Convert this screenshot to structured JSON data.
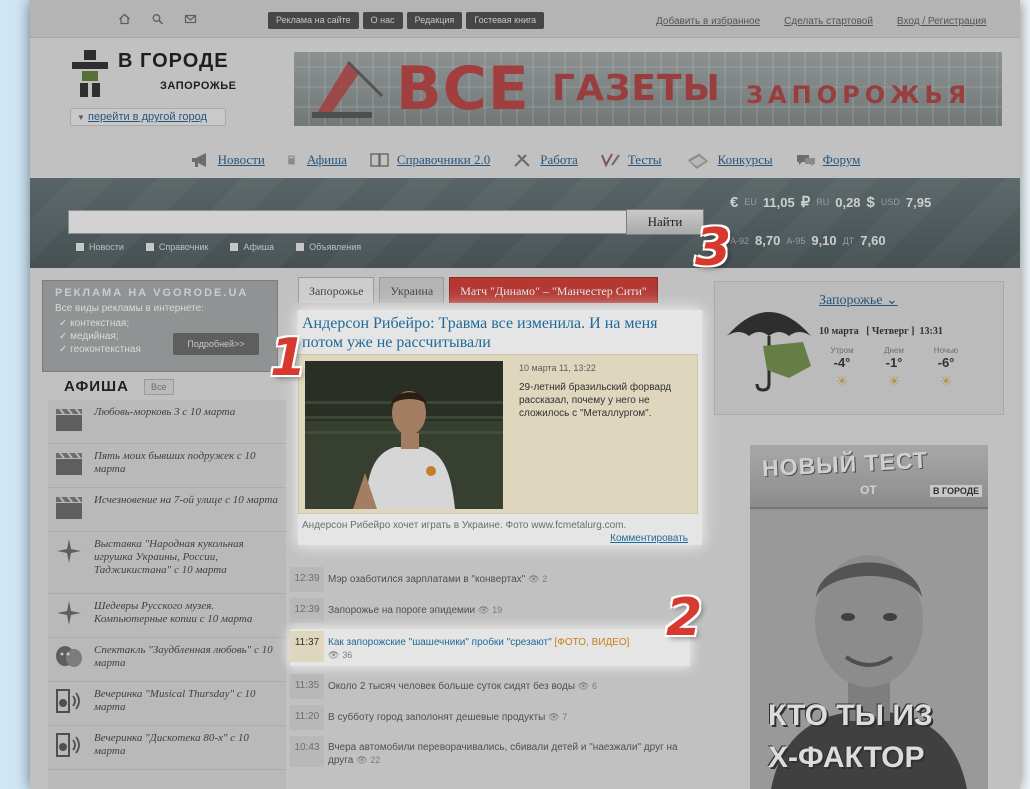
{
  "topbar": {
    "icons": [
      "home-icon",
      "search-icon",
      "mail-icon"
    ],
    "buttons": [
      "Реклама на сайте",
      "О нас",
      "Редакция",
      "Гостевая книга"
    ],
    "links": [
      "Добавить в избранное",
      "Сделать стартовой",
      "Вход / Регистрация"
    ]
  },
  "logo": {
    "title": "В ГОРОДЕ",
    "subtitle": "ЗАПОРОЖЬЕ"
  },
  "city_button": {
    "arrow": "▼",
    "label": "перейти в другой город"
  },
  "banner": {
    "big": "ВСЕ",
    "mid": "ГАЗЕТЫ",
    "small": "ЗАПОРОЖЬЯ"
  },
  "nav": [
    {
      "label": "Новости",
      "icon": "megaphone-icon"
    },
    {
      "label": "Афиша",
      "icon": "ticket-icon"
    },
    {
      "label": "Справочники 2.0",
      "icon": "book-icon"
    },
    {
      "label": "Работа",
      "icon": "tools-icon"
    },
    {
      "label": "Тесты",
      "icon": "test-icon"
    },
    {
      "label": "Конкурсы",
      "icon": "gift-icon"
    },
    {
      "label": "Форум",
      "icon": "forum-icon"
    }
  ],
  "search": {
    "value": "",
    "engine_arrow": "▼",
    "button": "Найти",
    "checks": [
      "Новости",
      "Справочник",
      "Афиша",
      "Объявления"
    ]
  },
  "rates": {
    "eur": {
      "sym": "€",
      "code": "EU",
      "value": "11,05"
    },
    "rub": {
      "sym": "₽",
      "code": "RU",
      "value": "0,28"
    },
    "usd": {
      "sym": "$",
      "code": "USD",
      "value": "7,95"
    }
  },
  "fuel": [
    {
      "code": "A-92",
      "value": "8,70"
    },
    {
      "code": "A-95",
      "value": "9,10"
    },
    {
      "code": "ДТ",
      "value": "7,60"
    }
  ],
  "ad": {
    "title": "РЕКЛАМА НА VGORODE.UA",
    "subtitle": "Все виды рекламы в интернете:",
    "items": [
      "✓ контекстная;",
      "✓ медийная;",
      "✓ геоконтекстная"
    ],
    "button": "Подробней>>"
  },
  "afisha": {
    "title": "АФИША",
    "all": "Все",
    "items": [
      {
        "text": "Любовь-морковь 3 с 10 марта",
        "icon": "clapper-icon"
      },
      {
        "text": "Пять моих бывших подружек с 10 марта",
        "icon": "clapper-icon"
      },
      {
        "text": "Исчезновение на 7-ой улице с 10 марта",
        "icon": "clapper-icon"
      },
      {
        "text": "Выставка \"Народная кукольная игрушка Украины, России, Таджикистана\" с 10 марта",
        "icon": "sparkle-icon"
      },
      {
        "text": "Шедевры Русского музея. Компьютерные копии с 10 марта",
        "icon": "sparkle-icon"
      },
      {
        "text": "Спектакль \"Заудбленная любовь\" с 10 марта",
        "icon": "masks-icon"
      },
      {
        "text": "Вечеринка \"Musical Thursday\" с 10 марта",
        "icon": "speaker-icon"
      },
      {
        "text": "Вечеринка \"Дискотека 80-х\" с 10 марта",
        "icon": "speaker-icon"
      }
    ]
  },
  "tabs": [
    "Запорожье",
    "Украина",
    "Матч \"Динамо\" – \"Манчестер Сити\""
  ],
  "feature": {
    "title": "Андерсон Рибейро: Травма все изменила. И на меня потом уже не рассчитывали",
    "date": "10 марта 11, 13:22",
    "lead": "29-летний бразильский форвард рассказал, почему у него не сложилось с \"Металлургом\".",
    "caption": "Андерсон Рибейро хочет играть в Украине. Фото www.fcmetalurg.com.",
    "comment": "Комментировать"
  },
  "news": [
    {
      "time": "12:39",
      "text": "Мэр озаботился зарплатами в \"конвертах\"",
      "tag": "",
      "views": "2"
    },
    {
      "time": "12:39",
      "text": "Запорожье на пороге эпидемии",
      "tag": "",
      "views": "19"
    },
    {
      "time": "11:37",
      "text": "Как запорожские \"шашечники\" пробки \"срезают\"",
      "tag": "[ФОТО, ВИДЕО]",
      "views": "36"
    },
    {
      "time": "11:35",
      "text": "Около 2 тысяч человек больше суток сидят без воды",
      "tag": "",
      "views": "6"
    },
    {
      "time": "11:20",
      "text": "В субботу город заполонят дешевые продукты",
      "tag": "",
      "views": "7"
    },
    {
      "time": "10:43",
      "text": "Вчера автомобили переворачивались, сбивали детей и \"наезжали\" друг на друга",
      "tag": "",
      "views": "22"
    }
  ],
  "weather": {
    "city": "Запорожье",
    "arrow": "⌄",
    "date": "10 марта",
    "weekday": "[ Четверг ]",
    "time": "13:31",
    "periods": [
      {
        "label": "Утром",
        "temp": "-4°"
      },
      {
        "label": "Днем",
        "temp": "-1°"
      },
      {
        "label": "Ночью",
        "temp": "-6°"
      }
    ]
  },
  "promo": {
    "line1": "НОВЫЙ ТЕСТ",
    "line2": "ОТ",
    "line3": "В ГОРОДЕ",
    "line4": "КТО ТЫ ИЗ",
    "line5": "Х-ФАКТОР"
  },
  "annotations": [
    "1",
    "2",
    "3"
  ],
  "colors": {
    "accent_link": "#1e74a9",
    "tab_red": "#c83a33",
    "annotation": "#d7392f",
    "highlight_bg": "#f7f0d3"
  }
}
